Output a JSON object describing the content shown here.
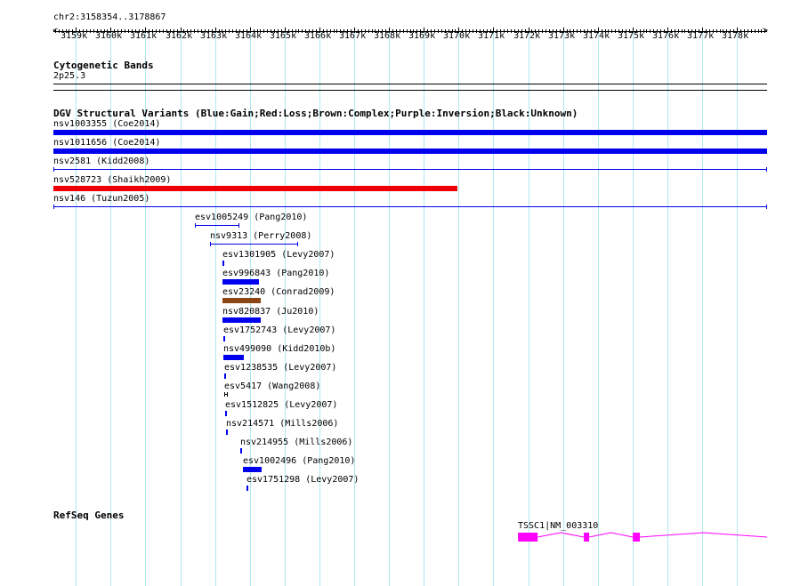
{
  "region": {
    "label": "chr2:3158354..3178867",
    "start": 3158354,
    "end": 3178867
  },
  "ruler": {
    "tick_labels": [
      "3159k",
      "3160k",
      "3161k",
      "3162k",
      "3163k",
      "3164k",
      "3165k",
      "3166k",
      "3167k",
      "3168k",
      "3169k",
      "3170k",
      "3171k",
      "3172k",
      "3173k",
      "3174k",
      "3175k",
      "3176k",
      "3177k",
      "3178k"
    ]
  },
  "cytoband": {
    "title": "Cytogenetic Bands",
    "band": "2p25.3"
  },
  "dgv": {
    "title": "DGV Structural Variants (Blue:Gain;Red:Loss;Brown:Complex;Purple:Inversion;Black:Unknown)",
    "colors": {
      "gain": "#0000ee",
      "loss": "#ee0000",
      "complex": "#8b4513",
      "unknown": "#000000"
    },
    "features": [
      {
        "label": "nsv1003355 (Coe2014)",
        "start": 3158354,
        "end": 3178867,
        "type": "gain",
        "style": "thick"
      },
      {
        "label": "nsv1011656 (Coe2014)",
        "start": 3158354,
        "end": 3178867,
        "type": "gain",
        "style": "thick"
      },
      {
        "label": "nsv2581 (Kidd2008)",
        "start": 3158354,
        "end": 3178867,
        "type": "gain",
        "style": "line"
      },
      {
        "label": "nsv528723 (Shaikh2009)",
        "start": 3158354,
        "end": 3169965,
        "type": "loss",
        "style": "thick"
      },
      {
        "label": "nsv146 (Tuzun2005)",
        "start": 3158354,
        "end": 3178867,
        "type": "gain",
        "style": "line"
      },
      {
        "label": "esv1005249 (Pang2010)",
        "start": 3162420,
        "end": 3163699,
        "type": "gain",
        "style": "line"
      },
      {
        "label": "nsv9313 (Perry2008)",
        "start": 3162855,
        "end": 3165387,
        "type": "gain",
        "style": "line"
      },
      {
        "label": "esv1301905 (Levy2007)",
        "start": 3163213,
        "end": 3163264,
        "type": "gain",
        "style": "thick"
      },
      {
        "label": "esv996843 (Pang2010)",
        "start": 3163213,
        "end": 3164262,
        "type": "gain",
        "style": "thick"
      },
      {
        "label": "esv23240 (Conrad2009)",
        "start": 3163213,
        "end": 3164313,
        "type": "complex",
        "style": "thick"
      },
      {
        "label": "nsv820837 (Ju2010)",
        "start": 3163213,
        "end": 3164313,
        "type": "gain",
        "style": "thick"
      },
      {
        "label": "esv1752743 (Levy2007)",
        "start": 3163239,
        "end": 3163290,
        "type": "gain",
        "style": "thick"
      },
      {
        "label": "nsv499090 (Kidd2010b)",
        "start": 3163239,
        "end": 3163827,
        "type": "gain",
        "style": "thick"
      },
      {
        "label": "esv1238535 (Levy2007)",
        "start": 3163264,
        "end": 3163316,
        "type": "gain",
        "style": "thick"
      },
      {
        "label": "esv5417 (Wang2008)",
        "start": 3163264,
        "end": 3163367,
        "type": "unknown",
        "style": "line"
      },
      {
        "label": "esv1512825 (Levy2007)",
        "start": 3163290,
        "end": 3163341,
        "type": "gain",
        "style": "thick"
      },
      {
        "label": "nsv214571 (Mills2006)",
        "start": 3163316,
        "end": 3163367,
        "type": "gain",
        "style": "thick"
      },
      {
        "label": "nsv214955 (Mills2006)",
        "start": 3163725,
        "end": 3163776,
        "type": "gain",
        "style": "thick"
      },
      {
        "label": "esv1002496 (Pang2010)",
        "start": 3163801,
        "end": 3164339,
        "type": "gain",
        "style": "thick"
      },
      {
        "label": "esv1751298 (Levy2007)",
        "start": 3163904,
        "end": 3163955,
        "type": "gain",
        "style": "thick"
      }
    ]
  },
  "refseq": {
    "title": "RefSeq Genes",
    "color": "#ff00ff",
    "gene": {
      "label": "TSSC1|NM_003310",
      "start": 3171709,
      "end": 3178867,
      "exons": [
        [
          3171709,
          3172272
        ],
        [
          3173599,
          3173753
        ],
        [
          3175006,
          3175211
        ]
      ]
    }
  }
}
